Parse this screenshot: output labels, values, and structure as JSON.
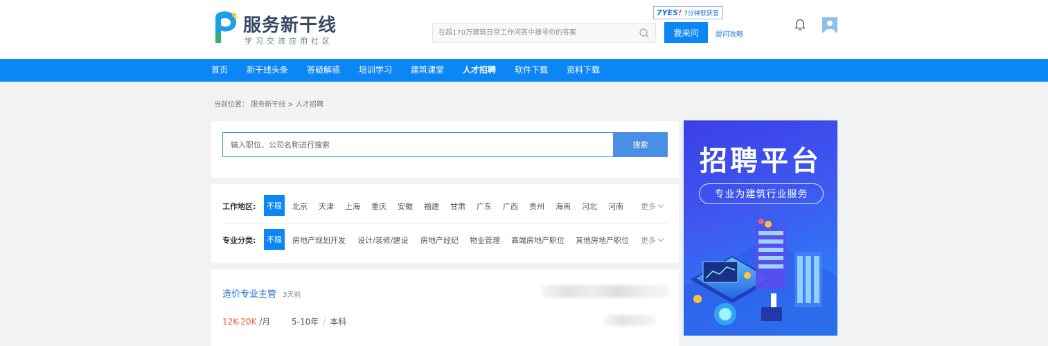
{
  "header": {
    "logo_title": "服务新干线",
    "logo_subtitle": "学习交流应用社区",
    "search_placeholder": "在超170万建筑日常工作问答中搜寻你的答案",
    "ask_button": "我来问",
    "ask_tips": "提问攻略",
    "badge_logo": "7YES",
    "badge_excl": "!",
    "badge_text": "7分钟就获答"
  },
  "nav": {
    "items": [
      {
        "label": "首页"
      },
      {
        "label": "新干线头条"
      },
      {
        "label": "答疑解惑"
      },
      {
        "label": "培训学习"
      },
      {
        "label": "建筑课堂"
      },
      {
        "label": "人才招聘",
        "active": true
      },
      {
        "label": "软件下载"
      },
      {
        "label": "资料下载"
      }
    ]
  },
  "breadcrumb": "当前位置： 服务新干线 > 人才招聘",
  "job_search": {
    "placeholder": "输入职位、公司名称进行搜索",
    "button": "搜索"
  },
  "filters": {
    "region": {
      "label": "工作地区:",
      "active": "不限",
      "options": [
        "北京",
        "天津",
        "上海",
        "重庆",
        "安徽",
        "福建",
        "甘肃",
        "广东",
        "广西",
        "贵州",
        "海南",
        "河北",
        "河南"
      ],
      "more": "更多"
    },
    "category": {
      "label": "专业分类:",
      "active": "不限",
      "options": [
        "房地产规划开发",
        "设计/装修/建设",
        "房地产经纪",
        "物业管理",
        "高端房地产职位",
        "其他房地产职位"
      ],
      "more": "更多"
    }
  },
  "job": {
    "title": "造价专业主管",
    "posted": "3天前",
    "salary": "12K-20K",
    "salary_unit": "/月",
    "experience": "5-10年",
    "separator": "/",
    "education": "本科"
  },
  "banner": {
    "title": "招聘平台",
    "subtitle": "专业为建筑行业服务"
  },
  "colors": {
    "primary": "#0d86f5",
    "salary": "#f05a2a",
    "link": "#1d6fd1"
  }
}
